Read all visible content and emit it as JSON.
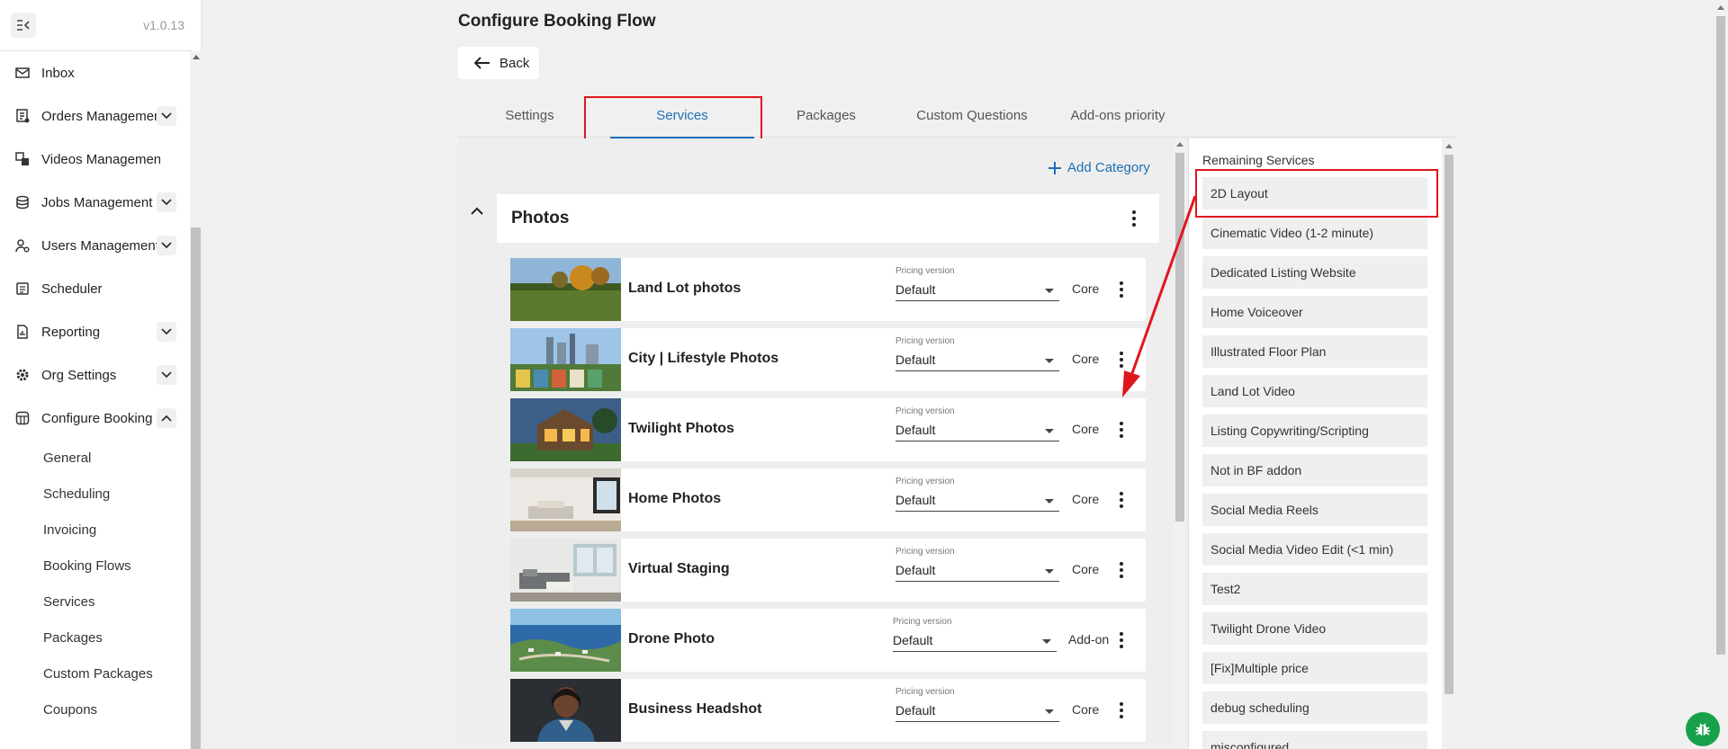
{
  "app": {
    "version": "v1.0.13"
  },
  "sidebar": {
    "items": [
      {
        "label": "Inbox",
        "icon": "inbox-icon",
        "expandable": false
      },
      {
        "label": "Orders Management",
        "icon": "orders-icon",
        "expandable": true
      },
      {
        "label": "Videos Management",
        "icon": "videos-icon",
        "expandable": false
      },
      {
        "label": "Jobs Management",
        "icon": "jobs-icon",
        "expandable": true
      },
      {
        "label": "Users Management",
        "icon": "users-icon",
        "expandable": true
      },
      {
        "label": "Scheduler",
        "icon": "scheduler-icon",
        "expandable": false
      },
      {
        "label": "Reporting",
        "icon": "reporting-icon",
        "expandable": true
      },
      {
        "label": "Org Settings",
        "icon": "gear-icon",
        "expandable": true
      },
      {
        "label": "Configure Booking",
        "icon": "booking-icon",
        "expandable": true,
        "expanded": true
      }
    ],
    "subitems": [
      "General",
      "Scheduling",
      "Invoicing",
      "Booking Flows",
      "Services",
      "Packages",
      "Custom Packages",
      "Coupons"
    ]
  },
  "page": {
    "title": "Configure Booking Flow",
    "back_label": "Back",
    "tabs": [
      "Settings",
      "Services",
      "Packages",
      "Custom Questions",
      "Add-ons priority"
    ],
    "active_tab": "Services",
    "add_category_label": "Add Category"
  },
  "category": {
    "title": "Photos",
    "pricing_label": "Pricing version",
    "services": [
      {
        "name": "Land Lot photos",
        "pricing": "Default",
        "type": "Core"
      },
      {
        "name": "City | Lifestyle Photos",
        "pricing": "Default",
        "type": "Core"
      },
      {
        "name": "Twilight Photos",
        "pricing": "Default",
        "type": "Core"
      },
      {
        "name": "Home Photos",
        "pricing": "Default",
        "type": "Core"
      },
      {
        "name": "Virtual Staging",
        "pricing": "Default",
        "type": "Core"
      },
      {
        "name": "Drone Photo",
        "pricing": "Default",
        "type": "Add-on"
      },
      {
        "name": "Business Headshot",
        "pricing": "Default",
        "type": "Core"
      }
    ]
  },
  "remaining": {
    "title": "Remaining Services",
    "items": [
      "2D Layout",
      "Cinematic Video (1-2 minute)",
      "Dedicated Listing Website",
      "Home Voiceover",
      "Illustrated Floor Plan",
      "Land Lot Video",
      "Listing Copywriting/Scripting",
      "Not in BF addon",
      "Social Media Reels",
      "Social Media Video Edit (<1 min)",
      "Test2",
      "Twilight Drone Video",
      "[Fix]Multiple price",
      "debug scheduling",
      "misconfigured"
    ]
  },
  "colors": {
    "accent": "#1f6fb6",
    "annotation": "#e0161e",
    "bug_button": "#18a14a"
  }
}
